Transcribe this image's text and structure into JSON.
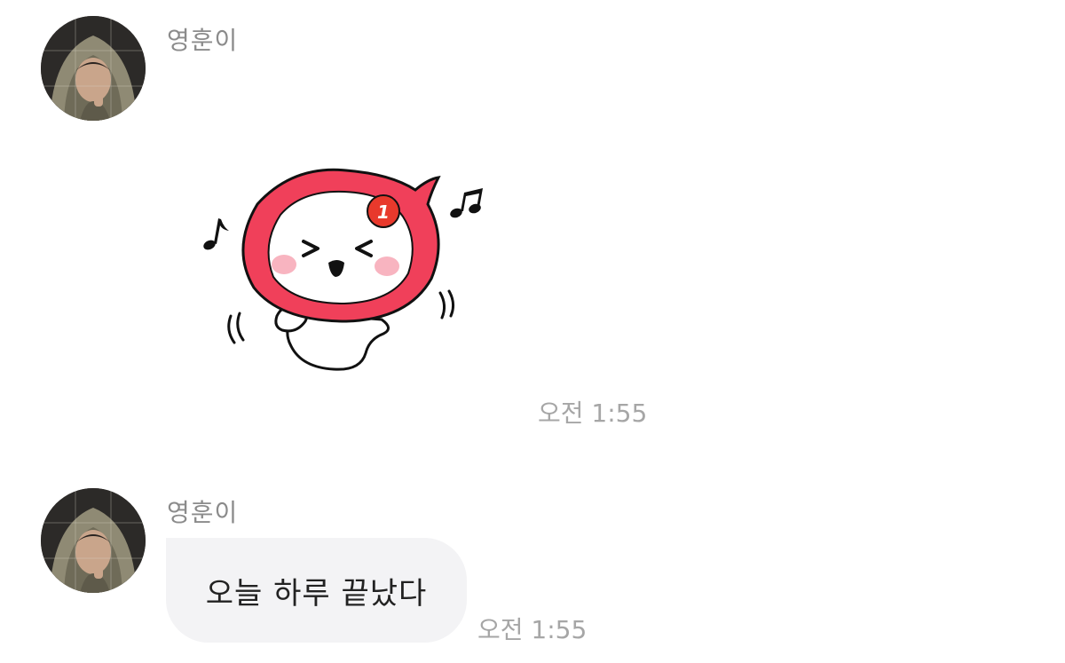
{
  "messages": [
    {
      "sender": "영훈이",
      "type": "sticker",
      "sticker": {
        "badge": "1",
        "icon": "dancing-red-speech-bubble-sticker"
      },
      "time": "오전 1:55"
    },
    {
      "sender": "영훈이",
      "type": "text",
      "text": "오늘 하루 끝났다",
      "time": "오전 1:55"
    }
  ],
  "colors": {
    "sticker_red": "#f0405a",
    "bubble_bg": "#f3f3f5",
    "name_gray": "#8b8b8b",
    "time_gray": "#a6a6a6"
  }
}
